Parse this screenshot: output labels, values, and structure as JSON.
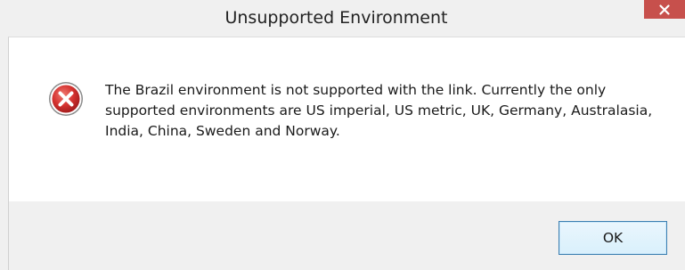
{
  "window": {
    "title": "Unsupported Environment",
    "close_icon": "close-icon",
    "close_color": "#c7504c"
  },
  "body": {
    "icon": "error-icon",
    "icon_color": "#c0262c",
    "message": "The Brazil environment is not supported with the link. Currently the only supported environments are US imperial, US metric, UK, Germany, Australasia, India, China, Sweden and Norway."
  },
  "buttons": {
    "ok_label": "OK"
  }
}
